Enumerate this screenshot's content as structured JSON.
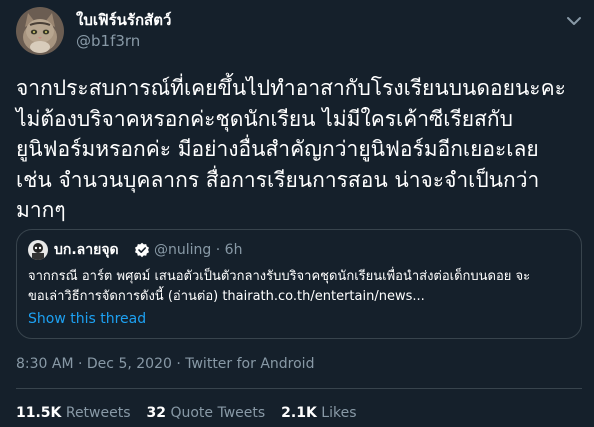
{
  "tweet": {
    "author": {
      "display_name": "ใบเฟิร์นรักสัตว์",
      "handle": "@b1f3rn",
      "avatar_icon": "cat-avatar-icon"
    },
    "more_icon": "chevron-down-icon",
    "text": "จากประสบการณ์ที่เคยขึ้นไปทำอาสากับโรงเรียนบนดอยนะคะ\nไม่ต้องบริจาคหรอกค่ะชุดนักเรียน ไม่มีใครเค้าซีเรียสกับ\nยูนิฟอร์มหรอกค่ะ มีอย่างอื่นสำคัญกว่ายูนิฟอร์มอีกเยอะเลย\nเช่น จำนวนบุคลากร สื่อการเรียนการสอน น่าจะจำเป็นกว่า\nมากๆ",
    "quoted": {
      "display_name": "บก.ลายจุด",
      "verified_icon": "verified-badge-icon",
      "handle": "@nuling",
      "separator": "·",
      "time": "6h",
      "text": "จากกรณี อาร์ต พศุตม์ เสนอตัวเป็นตัวกลางรับบริจาคชุดนักเรียนเพื่อนำส่งต่อเด็กบนดอย จะ\nขอเล่าวิธีการจัดการดังนี้ (อ่านต่อ) thairath.co.th/entertain/news...",
      "thread_link": "Show this thread"
    },
    "timestamp": {
      "time": "8:30 AM",
      "separator": "·",
      "date": "Dec 5, 2020",
      "separator2": "·",
      "source": "Twitter for Android"
    },
    "stats": {
      "retweets_count": "11.5K",
      "retweets_label": "Retweets",
      "quote_count": "32",
      "quote_label": "Quote Tweets",
      "likes_count": "2.1K",
      "likes_label": "Likes"
    }
  },
  "colors": {
    "background": "#15202b",
    "text": "#ffffff",
    "secondary": "#8899a6",
    "accent": "#1da1f2",
    "border": "#38444d"
  }
}
